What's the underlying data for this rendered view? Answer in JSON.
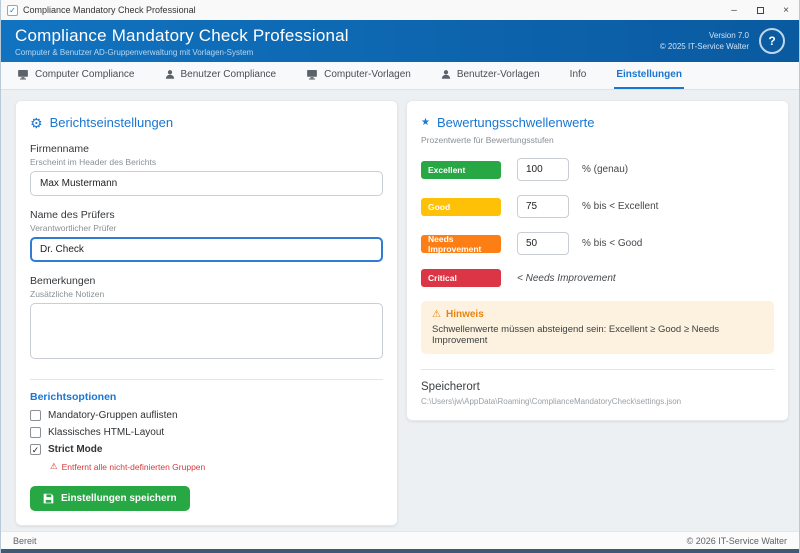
{
  "window": {
    "titlebar": {
      "title": "Compliance Mandatory Check Professional",
      "app_icon": "✓",
      "close": "×"
    },
    "header": {
      "title": "Compliance Mandatory Check Professional",
      "subtitle": "Computer & Benutzer AD-Gruppenverwaltung mit Vorlagen-System",
      "version": "Version 7.0",
      "copyright": "© 2025 IT-Service Walter",
      "help": "?"
    },
    "statusbar": {
      "left": "Bereit",
      "right": "© 2026 IT-Service Walter"
    }
  },
  "tabs": [
    {
      "label": "Computer Compliance",
      "icon": "computer",
      "active": false
    },
    {
      "label": "Benutzer Compliance",
      "icon": "user",
      "active": false
    },
    {
      "label": "Computer-Vorlagen",
      "icon": "computer",
      "active": false
    },
    {
      "label": "Benutzer-Vorlagen",
      "icon": "user",
      "active": false
    },
    {
      "label": "Info",
      "icon": null,
      "active": false
    },
    {
      "label": "Einstellungen",
      "icon": null,
      "active": true
    }
  ],
  "report_settings": {
    "title": "Berichtseinstellungen",
    "fields": [
      {
        "label": "Firmenname",
        "hint": "Erscheint im Header des Berichts",
        "value": "Max Mustermann",
        "type": "text",
        "focused": false
      },
      {
        "label": "Name des Prüfers",
        "hint": "Verantwortlicher Prüfer",
        "value": "Dr. Check",
        "type": "text",
        "focused": true
      },
      {
        "label": "Bemerkungen",
        "hint": "Zusätzliche Notizen",
        "value": "",
        "type": "textarea",
        "focused": false
      }
    ],
    "options_title": "Berichtsoptionen",
    "options": [
      {
        "label": "Mandatory-Gruppen auflisten",
        "checked": false,
        "bold": false,
        "warning": null
      },
      {
        "label": "Klassisches HTML-Layout",
        "checked": false,
        "bold": false,
        "warning": null
      },
      {
        "label": "Strict Mode",
        "checked": true,
        "bold": true,
        "warning": "Entfernt alle nicht-definierten Gruppen"
      }
    ],
    "save_button": "Einstellungen speichern"
  },
  "thresholds": {
    "title": "Bewertungsschwellenwerte",
    "subtitle": "Prozentwerte für Bewertungsstufen",
    "rows": [
      {
        "badge": "Excellent",
        "color": "#28a745",
        "value": "100",
        "suffix": "% (genau)",
        "italic": false
      },
      {
        "badge": "Good",
        "color": "#ffc107",
        "value": "75",
        "suffix": "% bis < Excellent",
        "italic": false
      },
      {
        "badge": "Needs Improvement",
        "color": "#fd7e14",
        "value": "50",
        "suffix": "% bis < Good",
        "italic": false
      },
      {
        "badge": "Critical",
        "color": "#dc3545",
        "value": null,
        "suffix": "< Needs Improvement",
        "italic": true
      }
    ],
    "notice": {
      "title": "Hinweis",
      "text": "Schwellenwerte müssen absteigend sein: Excellent ≥ Good ≥ Needs Improvement"
    },
    "storage": {
      "title": "Speicherort",
      "path": "C:\\Users\\jw\\AppData\\Roaming\\ComplianceMandatoryCheck\\settings.json"
    }
  }
}
